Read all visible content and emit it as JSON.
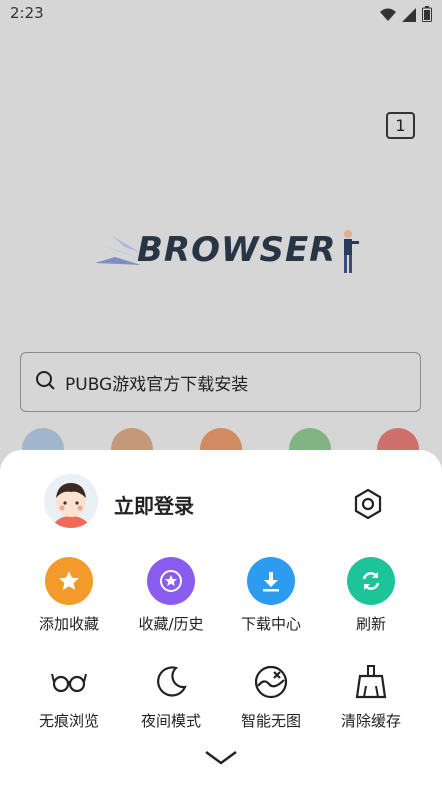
{
  "status_bar": {
    "time": "2:23",
    "icons": [
      "wifi-icon",
      "signal-icon",
      "battery-icon"
    ]
  },
  "browser": {
    "tab_count": "1",
    "logo_text": "BROWSER",
    "search_placeholder": "PUBG游戏官方下载安装"
  },
  "shortcuts": [
    {
      "icon": "shortcut-1-icon",
      "color": "#6fa8d6"
    },
    {
      "icon": "shortcut-2-icon",
      "color": "#e07a3a"
    },
    {
      "icon": "taobao-icon",
      "color": "#f0662a"
    },
    {
      "icon": "book-icon",
      "color": "#4caf50"
    },
    {
      "icon": "shortcut-5-icon",
      "color": "#e5322d"
    }
  ],
  "menu": {
    "login_label": "立即登录",
    "row1": [
      {
        "label": "添加收藏",
        "icon": "star-icon",
        "color": "#f39a2a"
      },
      {
        "label": "收藏/历史",
        "icon": "star-history-icon",
        "color": "#8b5cf0"
      },
      {
        "label": "下载中心",
        "icon": "download-icon",
        "color": "#2d9bf0"
      },
      {
        "label": "刷新",
        "icon": "refresh-icon",
        "color": "#1dc49a"
      }
    ],
    "row2": [
      {
        "label": "无痕浏览",
        "icon": "glasses-icon"
      },
      {
        "label": "夜间模式",
        "icon": "moon-icon"
      },
      {
        "label": "智能无图",
        "icon": "no-image-icon"
      },
      {
        "label": "清除缓存",
        "icon": "broom-icon"
      }
    ]
  },
  "colors": {
    "overlay_bg": "#d6d6d6",
    "sheet_bg": "#ffffff",
    "text": "#222222"
  }
}
